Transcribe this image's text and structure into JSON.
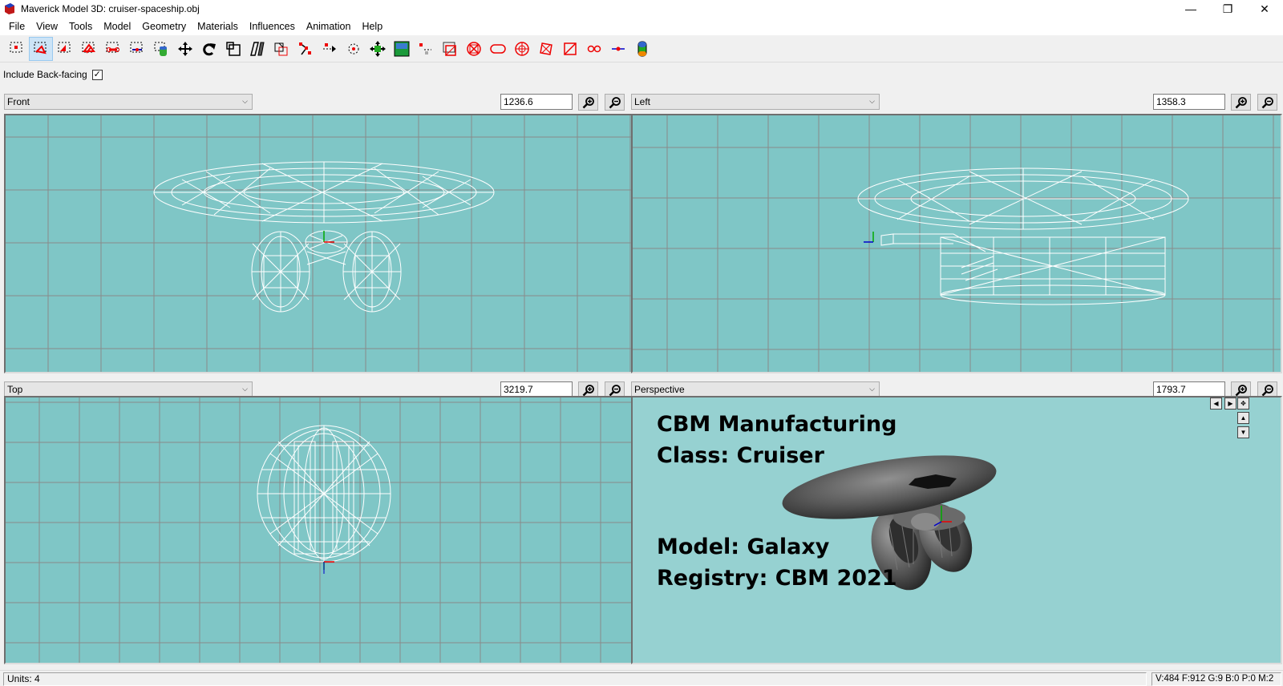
{
  "window": {
    "title": "Maverick Model 3D: cruiser-spaceship.obj",
    "controls": {
      "minimize": "—",
      "restore": "❐",
      "close": "✕"
    }
  },
  "menu": [
    "File",
    "View",
    "Tools",
    "Model",
    "Geometry",
    "Materials",
    "Influences",
    "Animation",
    "Help"
  ],
  "toolbar": {
    "tools": [
      "select-connected-icon",
      "select-vertices-icon",
      "select-faces-icon",
      "select-groups-icon",
      "select-bone-joints-icon",
      "select-points-icon",
      "select-projections-icon",
      "move-icon",
      "rotate-icon",
      "scale-icon",
      "shear-icon",
      "extrude-icon",
      "attach-vertex-icon",
      "create-vertex-icon",
      "create-point-icon",
      "create-bone-joint-icon",
      "create-projection-icon",
      "create-polygon-icon",
      "create-rectangle-icon",
      "create-cube-icon",
      "create-ellipsoid-icon",
      "create-cylinder-icon",
      "create-torus-icon",
      "bg-grid-icon",
      "drag-vertex-icon",
      "texture-projection-icon",
      "paint-texture-icon",
      "cylinder-tool-icon"
    ],
    "active_tool": "select-vertices-icon"
  },
  "options": {
    "include_backfacing_label": "Include Back-facing",
    "include_backfacing_checked": "✓"
  },
  "viewports": [
    {
      "view": "Front",
      "zoom": "1236.6"
    },
    {
      "view": "Left",
      "zoom": "1358.3"
    },
    {
      "view": "Top",
      "zoom": "3219.7"
    },
    {
      "view": "Perspective",
      "zoom": "1793.7"
    }
  ],
  "perspective_overlay": {
    "line1": "CBM Manufacturing",
    "line2": "Class: Cruiser",
    "line3": "Model: Galaxy",
    "line4": "Registry: CBM 2021"
  },
  "colors": {
    "viewport_bg": "#7fc6c6",
    "grid_line": "#8a8a8a",
    "wireframe": "#ffffff",
    "perspective_bg": "#96d1d1"
  },
  "status": {
    "units": "Units: 4",
    "counts": "V:484 F:912 G:9 B:0 P:0 M:2"
  }
}
